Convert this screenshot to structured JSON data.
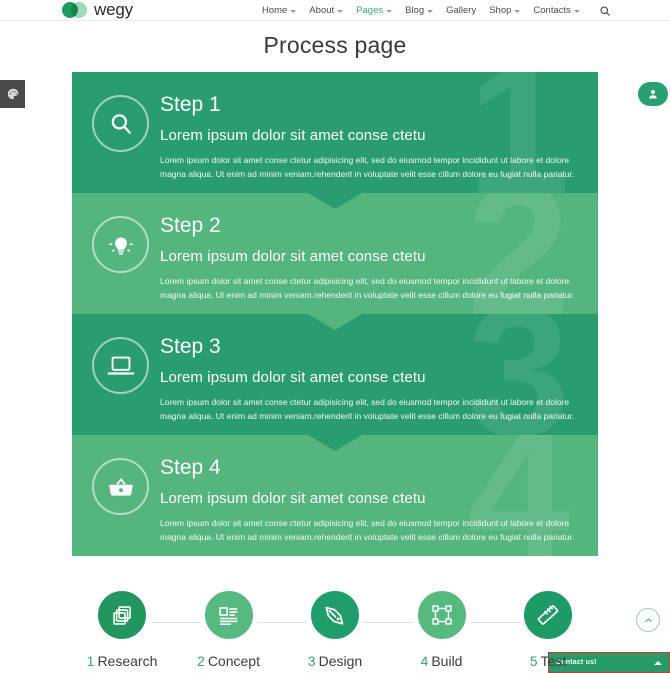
{
  "header": {
    "logo_text": "wegy",
    "logo_icon": "two-overlapping-circles-icon",
    "nav": [
      {
        "label": "Home",
        "has_caret": true,
        "active": false
      },
      {
        "label": "About",
        "has_caret": true,
        "active": false
      },
      {
        "label": "Pages",
        "has_caret": true,
        "active": true
      },
      {
        "label": "Blog",
        "has_caret": true,
        "active": false
      },
      {
        "label": "Gallery",
        "has_caret": false,
        "active": false
      },
      {
        "label": "Shop",
        "has_caret": true,
        "active": false
      },
      {
        "label": "Contacts",
        "has_caret": true,
        "active": false
      }
    ],
    "search_icon": "search-icon"
  },
  "page": {
    "title": "Process page"
  },
  "steps": [
    {
      "number": "1",
      "title": "Step 1",
      "subtitle": "Lorem ipsum dolor sit amet conse ctetu",
      "text": "Lorem ipsum dolor sit amet conse ctetur adipisicing elit, sed do eiusmod tempor incididunt ut labore et dolore magna aliqua. Ut enim ad minim veniam.rehenderit in voluptate velit esse cillum dolore eu fugiat nulla pariatur.",
      "icon": "search-icon",
      "tone": "dark"
    },
    {
      "number": "2",
      "title": "Step 2",
      "subtitle": "Lorem ipsum dolor sit amet conse ctetu",
      "text": "Lorem ipsum dolor sit amet conse ctetur adipisicing elit, sed do eiusmod tempor incididunt ut labore et dolore magna aliqua. Ut enim ad minim veniam.rehenderit in voluptate velit esse cillum dolore eu fugiat nulla pariatur.",
      "icon": "lightbulb-icon",
      "tone": "light"
    },
    {
      "number": "3",
      "title": "Step 3",
      "subtitle": "Lorem ipsum dolor sit amet conse ctetu",
      "text": "Lorem ipsum dolor sit amet conse ctetur adipisicing elit, sed do eiusmod tempor incididunt ut labore et dolore magna aliqua. Ut enim ad minim veniam.rehenderit in voluptate velit esse cillum dolore eu fugiat nulla pariatur.",
      "icon": "laptop-icon",
      "tone": "dark"
    },
    {
      "number": "4",
      "title": "Step 4",
      "subtitle": "Lorem ipsum dolor sit amet conse ctetu",
      "text": "Lorem ipsum dolor sit amet conse ctetur adipisicing elit, sed do eiusmod tempor incididunt ut labore et dolore magna aliqua. Ut enim ad minim veniam.rehenderit in voluptate velit esse cillum dolore eu fugiat nulla pariatur.",
      "icon": "shopping-basket-icon",
      "tone": "light"
    }
  ],
  "process": [
    {
      "num": "1",
      "label": "Research",
      "icon": "layers-icon",
      "color": "#23955f"
    },
    {
      "num": "2",
      "label": "Concept",
      "icon": "document-icon",
      "color": "#56b980"
    },
    {
      "num": "3",
      "label": "Design",
      "icon": "pen-nib-icon",
      "color": "#1f9e6b"
    },
    {
      "num": "4",
      "label": "Build",
      "icon": "transform-icon",
      "color": "#56b980"
    },
    {
      "num": "5",
      "label": "Test",
      "icon": "ruler-icon",
      "color": "#1d9a66"
    }
  ],
  "widgets": {
    "theme_button_icon": "palette-icon",
    "user_button_icon": "user-icon",
    "to_top_icon": "chevron-up-icon",
    "contact": {
      "label": "Contact us!",
      "caret_icon": "chevron-up-icon"
    }
  },
  "colors": {
    "brand_green": "#2a9d70",
    "brand_green_light": "#55b57f",
    "accent_text": "#35a873",
    "title_text": "#3a3a3a"
  }
}
